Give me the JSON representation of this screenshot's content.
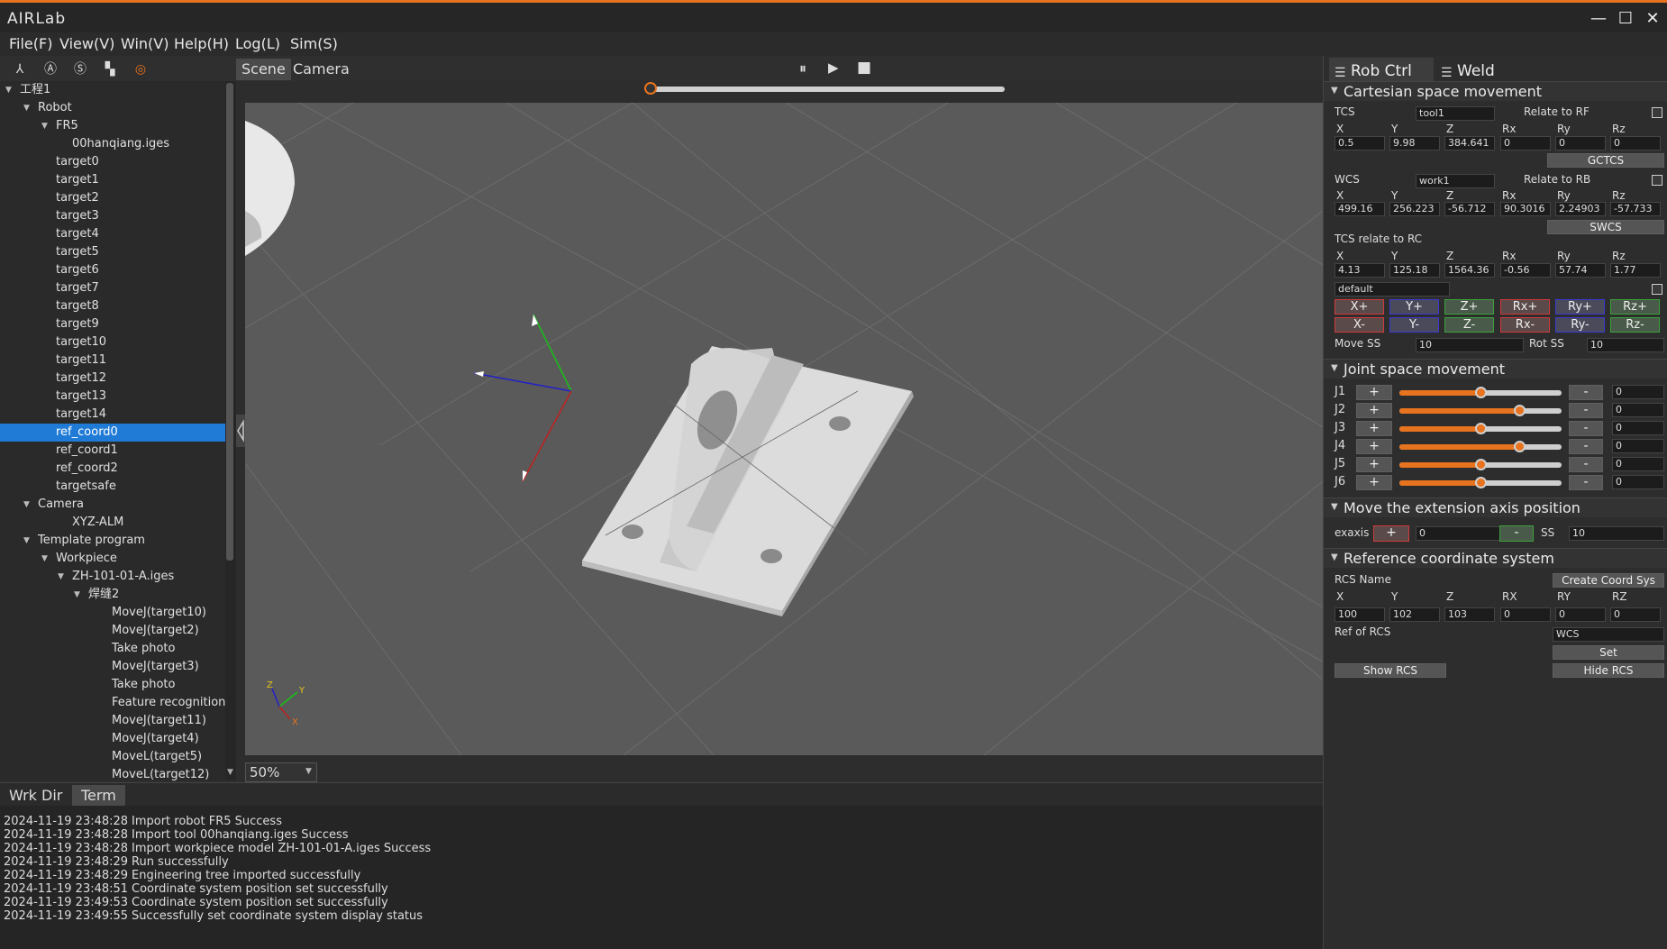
{
  "app": {
    "title": "AIRLab"
  },
  "window": {
    "minimize": "—",
    "maximize": "☐",
    "close": "✕"
  },
  "menu": [
    "File(F)",
    "View(V)",
    "Win(V)",
    "Help(H)",
    "Log(L)",
    "Sim(S)"
  ],
  "left_tools": [
    "⅄",
    "Ⓐ",
    "Ⓢ",
    "▚",
    "◎"
  ],
  "tree": [
    {
      "label": "工程1",
      "level": 0,
      "expanded": true
    },
    {
      "label": "Robot",
      "level": 1,
      "expanded": true
    },
    {
      "label": "FR5",
      "level": 2,
      "expanded": true
    },
    {
      "label": "00hanqiang.iges",
      "level": 3
    },
    {
      "label": "target0",
      "level": 2
    },
    {
      "label": "target1",
      "level": 2
    },
    {
      "label": "target2",
      "level": 2
    },
    {
      "label": "target3",
      "level": 2
    },
    {
      "label": "target4",
      "level": 2
    },
    {
      "label": "target5",
      "level": 2
    },
    {
      "label": "target6",
      "level": 2
    },
    {
      "label": "target7",
      "level": 2
    },
    {
      "label": "target8",
      "level": 2
    },
    {
      "label": "target9",
      "level": 2
    },
    {
      "label": "target10",
      "level": 2
    },
    {
      "label": "target11",
      "level": 2
    },
    {
      "label": "target12",
      "level": 2
    },
    {
      "label": "target13",
      "level": 2
    },
    {
      "label": "target14",
      "level": 2
    },
    {
      "label": "ref_coord0",
      "level": 2,
      "selected": true
    },
    {
      "label": "ref_coord1",
      "level": 2
    },
    {
      "label": "ref_coord2",
      "level": 2
    },
    {
      "label": "targetsafe",
      "level": 2
    },
    {
      "label": "Camera",
      "level": 1,
      "expanded": true
    },
    {
      "label": "XYZ-ALM",
      "level": 3
    },
    {
      "label": "Template program",
      "level": 1,
      "expanded": true
    },
    {
      "label": "Workpiece",
      "level": 2,
      "expanded": true
    },
    {
      "label": "ZH-101-01-A.iges",
      "level": 3,
      "expanded": true
    },
    {
      "label": "焊缝2",
      "level": 4,
      "expanded": true
    },
    {
      "label": "MoveJ(target10)",
      "level": 5
    },
    {
      "label": "MoveJ(target2)",
      "level": 5
    },
    {
      "label": "Take photo",
      "level": 5
    },
    {
      "label": "MoveJ(target3)",
      "level": 5
    },
    {
      "label": "Take photo",
      "level": 5
    },
    {
      "label": "Feature recognition",
      "level": 5
    },
    {
      "label": "MoveJ(target11)",
      "level": 5
    },
    {
      "label": "MoveJ(target4)",
      "level": 5
    },
    {
      "label": "MoveL(target5)",
      "level": 5
    },
    {
      "label": "MoveL(target12)",
      "level": 5
    }
  ],
  "viewport": {
    "tabs": [
      "Scene",
      "Camera"
    ],
    "active_tab": "Scene",
    "controls": {
      "pause": "⏸",
      "play": "▶",
      "stop": "■"
    },
    "zoom": "50%",
    "timeline_progress": 0,
    "axes": {
      "x": "X",
      "y": "Y",
      "z": "Z"
    }
  },
  "bottom": {
    "tabs": [
      "Wrk Dir",
      "Term"
    ],
    "active_tab": "Term",
    "log": [
      {
        "time": "2024-11-19 23:48:28",
        "msg": "Import robot FR5 Success"
      },
      {
        "time": "2024-11-19 23:48:28",
        "msg": "Import tool 00hanqiang.iges Success"
      },
      {
        "time": "2024-11-19 23:48:28",
        "msg": "Import workpiece model  ZH-101-01-A.iges Success"
      },
      {
        "time": "2024-11-19 23:48:29",
        "msg": "Run successfully"
      },
      {
        "time": "2024-11-19 23:48:29",
        "msg": "Engineering tree imported successfully"
      },
      {
        "time": "2024-11-19 23:48:51",
        "msg": "Coordinate system position set successfully"
      },
      {
        "time": "2024-11-19 23:49:53",
        "msg": "Coordinate system position set successfully"
      },
      {
        "time": "2024-11-19 23:49:55",
        "msg": "Successfully set coordinate system display status"
      }
    ]
  },
  "right": {
    "tabs": [
      "Rob Ctrl",
      "Weld"
    ],
    "cartesian": {
      "title": "Cartesian space movement",
      "tcs_label": "TCS",
      "tcs_value": "tool1",
      "relate_rf": "Relate to RF",
      "axis_labels": [
        "X",
        "Y",
        "Z",
        "Rx",
        "Ry",
        "Rz"
      ],
      "tcs_vals": [
        "0.5",
        "9.98",
        "384.641",
        "0",
        "0",
        "0"
      ],
      "gctcs": "GCTCS",
      "wcs_label": "WCS",
      "wcs_value": "work1",
      "relate_rb": "Relate to RB",
      "wcs_vals": [
        "499.16",
        "256.223",
        "-56.712",
        "90.3016",
        "2.24903",
        "-57.733"
      ],
      "swcs": "SWCS",
      "rc_label": "TCS relate to RC",
      "rc_vals": [
        "4.13",
        "125.18",
        "1564.36",
        "-0.56",
        "57.74",
        "1.77"
      ],
      "preset": "default",
      "jog_plus": [
        "X+",
        "Y+",
        "Z+",
        "Rx+",
        "Ry+",
        "Rz+"
      ],
      "jog_minus": [
        "X-",
        "Y-",
        "Z-",
        "Rx-",
        "Ry-",
        "Rz-"
      ],
      "move_ss_label": "Move SS",
      "move_ss": "10",
      "rot_ss_label": "Rot SS",
      "rot_ss": "10"
    },
    "joint": {
      "title": "Joint space movement",
      "plus": "+",
      "minus": "-",
      "joints": [
        {
          "name": "J1",
          "value": "0",
          "pos": 0.5
        },
        {
          "name": "J2",
          "value": "0",
          "pos": 0.74
        },
        {
          "name": "J3",
          "value": "0",
          "pos": 0.5
        },
        {
          "name": "J4",
          "value": "0",
          "pos": 0.74
        },
        {
          "name": "J5",
          "value": "0",
          "pos": 0.5
        },
        {
          "name": "J6",
          "value": "0",
          "pos": 0.5
        }
      ]
    },
    "ext": {
      "title": "Move the extension axis position",
      "label": "exaxis",
      "plus": "+",
      "value": "0",
      "minus": "-",
      "ss_label": "SS",
      "ss": "10"
    },
    "rcs": {
      "title": "Reference coordinate system",
      "name_label": "RCS Name",
      "create": "Create Coord Sys",
      "axis_labels": [
        "X",
        "Y",
        "Z",
        "RX",
        "RY",
        "RZ"
      ],
      "vals": [
        "100",
        "102",
        "103",
        "0",
        "0",
        "0"
      ],
      "ref_label": "Ref of RCS",
      "ref_value": "WCS",
      "set": "Set",
      "show": "Show RCS",
      "hide": "Hide RCS"
    }
  },
  "colors": {
    "accent": "#e8731f",
    "selection": "#1f7bd6",
    "viewport": "#5a5a5a"
  }
}
